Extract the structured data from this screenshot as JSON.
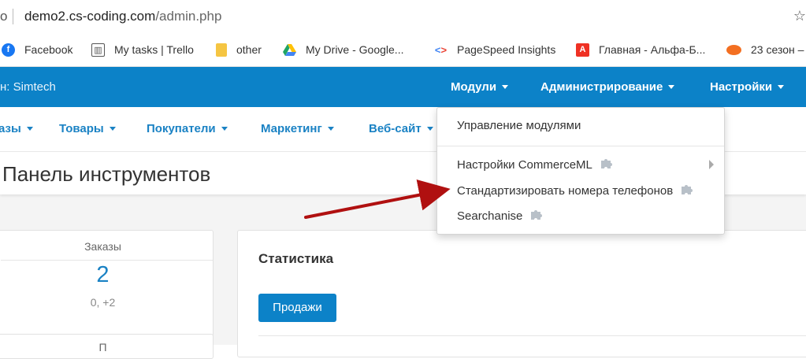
{
  "browser": {
    "url_prefix": "o",
    "url_host": "demo2.cs-coding.com",
    "url_path": "/admin.php",
    "star_icon": "star-icon"
  },
  "bookmarks": [
    {
      "label": "Facebook",
      "icon": "facebook-icon",
      "color": "#1877f2"
    },
    {
      "label": "My tasks | Trello",
      "icon": "trello-icon",
      "color": "#555555"
    },
    {
      "label": "other",
      "icon": "folder-icon",
      "color": "#f5c542"
    },
    {
      "label": "My Drive - Google...",
      "icon": "google-drive-icon",
      "color": "#1fa463"
    },
    {
      "label": "PageSpeed Insights",
      "icon": "pagespeed-icon",
      "color": "#4285f4"
    },
    {
      "label": "Главная - Альфа-Б...",
      "icon": "alfa-bank-icon",
      "color": "#ef3124"
    },
    {
      "label": "23 сезон –",
      "icon": "orange-icon",
      "color": "#f36f21"
    }
  ],
  "topbar": {
    "store": "н: Simtech",
    "menus": [
      "Модули",
      "Администрирование",
      "Настройки"
    ]
  },
  "subnav": [
    "азы",
    "Товары",
    "Покупатели",
    "Маркетинг",
    "Веб-сайт"
  ],
  "page_title": "Панель инструментов",
  "dropdown": {
    "items": [
      {
        "label": "Управление модулями"
      },
      {
        "label": "Настройки CommerceML",
        "has_submenu": true,
        "icon": "puzzle-icon"
      },
      {
        "label": "Стандартизировать номера телефонов",
        "icon": "puzzle-icon"
      },
      {
        "label": "Searchanise",
        "icon": "puzzle-icon"
      }
    ]
  },
  "dashboard": {
    "orders": {
      "label": "Заказы",
      "value": "2",
      "delta": "0, +2"
    },
    "second_card_label": "П",
    "stats": {
      "title": "Статистика",
      "button": "Продажи"
    }
  },
  "colors": {
    "primary": "#0c82c8",
    "link": "#1a82c4",
    "annotation_arrow": "#b01010"
  }
}
